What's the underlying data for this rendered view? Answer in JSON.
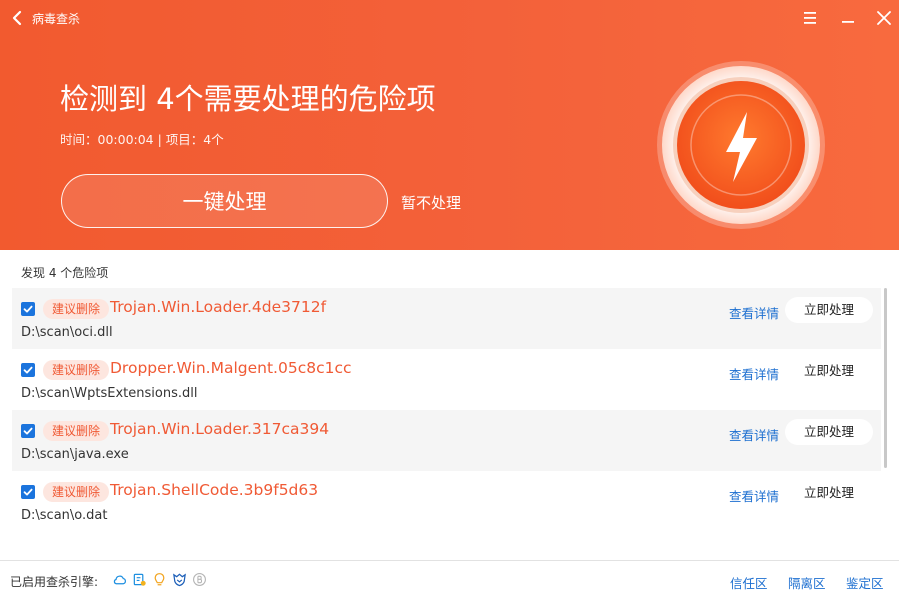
{
  "window": {
    "title": "病毒查杀"
  },
  "header": {
    "headline": "检测到 4个需要处理的危险项",
    "meta": "时间：00:00:04 | 项目：4个",
    "primary_action": "一键处理",
    "skip_action": "暂不处理"
  },
  "list": {
    "found_text": "发现 4 个危险项",
    "items": [
      {
        "badge": "建议删除",
        "name": "Trojan.Win.Loader.4de3712f",
        "path": "D:\\scan\\oci.dll",
        "detail": "查看详情",
        "action": "立即处理",
        "checked": true
      },
      {
        "badge": "建议删除",
        "name": "Dropper.Win.Malgent.05c8c1cc",
        "path": "D:\\scan\\WptsExtensions.dll",
        "detail": "查看详情",
        "action": "立即处理",
        "checked": true
      },
      {
        "badge": "建议删除",
        "name": "Trojan.Win.Loader.317ca394",
        "path": "D:\\scan\\java.exe",
        "detail": "查看详情",
        "action": "立即处理",
        "checked": true
      },
      {
        "badge": "建议删除",
        "name": "Trojan.ShellCode.3b9f5d63",
        "path": "D:\\scan\\o.dat",
        "detail": "查看详情",
        "action": "立即处理",
        "checked": true
      }
    ]
  },
  "footer": {
    "engines_label": "已启用查杀引擎:",
    "engine_icons": [
      "cloud-engine-icon",
      "ai-engine-icon",
      "qvm-engine-icon",
      "kunpeng-engine-icon",
      "bitdefender-engine-icon"
    ],
    "links": [
      "信任区",
      "隔离区",
      "鉴定区"
    ]
  },
  "colors": {
    "header_orange": "#f25a2f",
    "threat_red": "#f05a35",
    "link_blue": "#1d6fd0",
    "checkbox_blue": "#1b74dd"
  }
}
